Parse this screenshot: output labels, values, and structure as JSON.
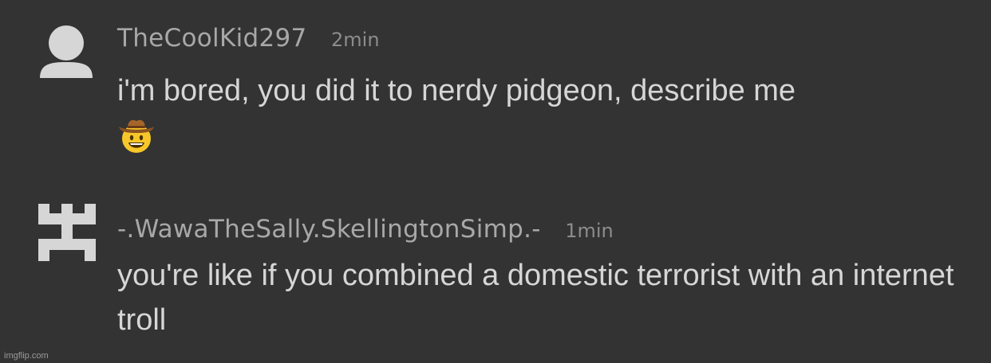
{
  "comments": [
    {
      "username": "TheCoolKid297",
      "time": "2min",
      "text": "i'm bored, you did it to nerdy pidgeon, describe me",
      "emoji": "cowboy-hat-face-icon"
    },
    {
      "username": "-.WawaTheSally.SkellingtonSimp.-",
      "time": "1min",
      "text": "you're like if you combined a domestic terrorist with an internet troll"
    }
  ],
  "watermark": "imgflip.com",
  "colors": {
    "background": "#333333",
    "username": "#a8a8a8",
    "time": "#8c8c8c",
    "text": "#d6d6d6",
    "avatar": "#d6d6d6"
  }
}
